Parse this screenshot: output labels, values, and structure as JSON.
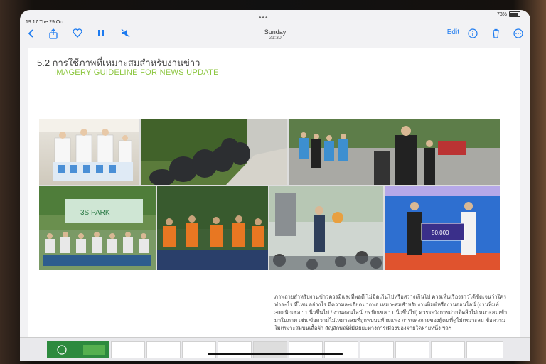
{
  "status": {
    "time_date": "19:17  Tue 29 Oct",
    "battery": "78%"
  },
  "toolbar": {
    "day": "Sunday",
    "time": "21:30",
    "edit_label": "Edit",
    "icons": [
      "back-icon",
      "share-icon",
      "heart-icon",
      "pause-icon",
      "mute-icon",
      "info-icon",
      "trash-icon",
      "more-icon"
    ]
  },
  "page": {
    "heading_th": "5.2  การใช้ภาพที่เหมาะสมสำหรับงานข่าว",
    "heading_en": "IMAGERY GUIDELINE FOR NEWS UPDATE",
    "collage_banner_text": "3S PARK",
    "award_board_text": "50,000",
    "caption": "ภาพถ่ายสำหรับงานข่าวควรมีแสงที่พอดี ไม่มืดเกินไปหรือสว่างเกินไป ควรเห็นเรื่องราวได้ชัดเจนว่าใคร ทำอะไร ที่ไหน อย่างไร มีความละเอียดมากพอ เหมาะสมสำหรับงานพิมพ์หรืองานออนไลน์ (งานพิมพ์ 300 พิกเซล : 1 นิ้วขึ้นไป / งานออนไลน์ 75 พิกเซล : 1 นิ้วขึ้นไป) ควรระวังการถ่ายติดสิ่งไม่เหมาะสมเข้ามาในภาพ เช่น ข้อความไม่เหมาะสมที่ถูกพบบนท้ายแฟง การแต่งกายของผู้คนที่ดูไม่เหมาะสม ข้อความไม่เหมาะสมบนเสื้อผ้า สัญลักษณ์ที่มีนัยยะทางการเมืองของฝ่ายใดฝ่ายหนึ่ง ฯลฯ"
  },
  "colors": {
    "accent_green": "#8cc63f",
    "ios_blue": "#1d7bf0"
  }
}
